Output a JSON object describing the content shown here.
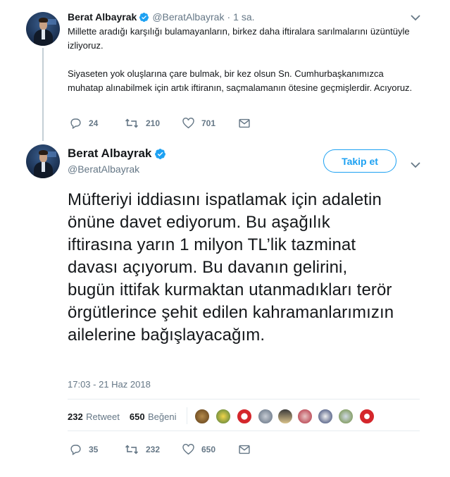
{
  "first_tweet": {
    "display_name": "Berat Albayrak",
    "handle": "@BeratAlbayrak",
    "separator": "·",
    "time": "1 sa.",
    "paragraph1": "Millette aradığı karşılığı bulamayanların, birkez daha iftiralara sarılmalarını üzüntüyle izliyoruz.",
    "paragraph2": "Siyaseten yok oluşlarına çare bulmak, bir kez olsun Sn. Cumhurbaşkanımızca muhatap alınabilmek için artık iftiranın, saçmalamanın ötesine geçmişlerdir. Acıyoruz.",
    "replies": "24",
    "retweets": "210",
    "likes": "701"
  },
  "main_tweet": {
    "display_name": "Berat Albayrak",
    "handle": "@BeratAlbayrak",
    "follow_label": "Takip et",
    "text": "Müfteriyi iddiasını ispatlamak için adaletin önüne davet ediyorum. Bu aşağılık iftirasına yarın 1 milyon TL’lik tazminat davası açıyorum. Bu davanın gelirini, bugün ittifak kurmaktan utanmadıkları terör örgütlerince şehit edilen kahramanlarımızın ailelerine bağışlayacağım.",
    "timestamp": "17:03 - 21 Haz 2018",
    "retweet_count": "232",
    "retweet_label": "Retweet",
    "like_count": "650",
    "like_label": "Beğeni",
    "replies": "35",
    "retweets": "232",
    "likes": "650"
  },
  "colors": {
    "accent": "#1da1f2",
    "muted": "#657786",
    "text": "#14171a",
    "thread_line": "#c4cfd6"
  },
  "icons": {
    "reply": "reply-icon",
    "retweet": "retweet-icon",
    "like": "heart-icon",
    "dm": "envelope-icon",
    "verified": "verified-badge-icon",
    "caret": "chevron-down-icon"
  }
}
